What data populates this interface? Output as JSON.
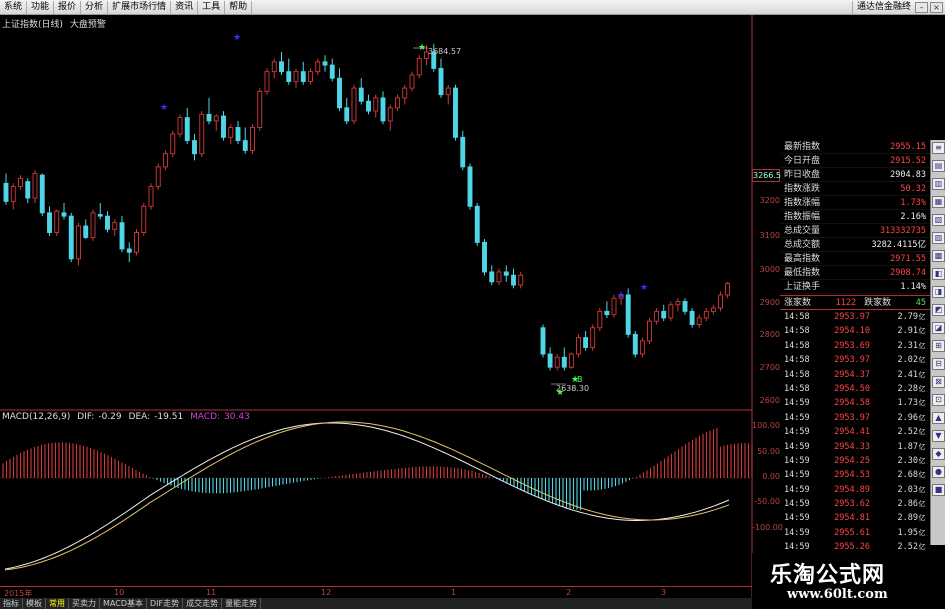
{
  "menu": {
    "items": [
      "系统",
      "功能",
      "报价",
      "分析",
      "扩展市场行情",
      "资讯",
      "工具",
      "帮助"
    ],
    "brand": "通达信金融终"
  },
  "chart_header": {
    "index_name": "上证指数(日线)",
    "indicator_name": "大盘预警"
  },
  "chart_data": {
    "type": "candlestick",
    "y_ticks": [
      "3200",
      "3100",
      "3000",
      "2900",
      "2800",
      "2700",
      "2600"
    ],
    "current_price_label": "3266.5",
    "annotations": {
      "high": "3684.57",
      "low": "2638.30",
      "buy_label": "B"
    },
    "candles": [
      [
        3260,
        3290,
        3195,
        3205
      ],
      [
        3205,
        3260,
        3180,
        3250
      ],
      [
        3250,
        3285,
        3240,
        3275
      ],
      [
        3265,
        3275,
        3200,
        3215
      ],
      [
        3215,
        3300,
        3200,
        3290
      ],
      [
        3285,
        3290,
        3160,
        3170
      ],
      [
        3170,
        3190,
        3100,
        3110
      ],
      [
        3110,
        3180,
        3100,
        3175
      ],
      [
        3170,
        3200,
        3150,
        3160
      ],
      [
        3160,
        3170,
        3020,
        3030
      ],
      [
        3030,
        3140,
        3010,
        3130
      ],
      [
        3130,
        3150,
        3090,
        3095
      ],
      [
        3095,
        3180,
        3085,
        3170
      ],
      [
        3165,
        3200,
        3150,
        3160
      ],
      [
        3160,
        3175,
        3110,
        3120
      ],
      [
        3120,
        3150,
        3100,
        3140
      ],
      [
        3140,
        3160,
        3050,
        3060
      ],
      [
        3060,
        3080,
        3020,
        3050
      ],
      [
        3050,
        3120,
        3040,
        3110
      ],
      [
        3110,
        3200,
        3100,
        3190
      ],
      [
        3190,
        3260,
        3180,
        3250
      ],
      [
        3250,
        3320,
        3240,
        3310
      ],
      [
        3310,
        3360,
        3300,
        3350
      ],
      [
        3350,
        3420,
        3340,
        3410
      ],
      [
        3410,
        3470,
        3400,
        3460
      ],
      [
        3460,
        3490,
        3380,
        3390
      ],
      [
        3390,
        3410,
        3330,
        3350
      ],
      [
        3350,
        3480,
        3340,
        3470
      ],
      [
        3470,
        3520,
        3440,
        3450
      ],
      [
        3450,
        3470,
        3420,
        3465
      ],
      [
        3465,
        3480,
        3390,
        3400
      ],
      [
        3400,
        3440,
        3380,
        3430
      ],
      [
        3430,
        3450,
        3380,
        3390
      ],
      [
        3390,
        3430,
        3350,
        3360
      ],
      [
        3360,
        3440,
        3350,
        3430
      ],
      [
        3430,
        3550,
        3420,
        3540
      ],
      [
        3540,
        3610,
        3530,
        3600
      ],
      [
        3600,
        3640,
        3580,
        3630
      ],
      [
        3630,
        3660,
        3590,
        3600
      ],
      [
        3600,
        3640,
        3560,
        3570
      ],
      [
        3570,
        3610,
        3550,
        3600
      ],
      [
        3600,
        3630,
        3560,
        3570
      ],
      [
        3570,
        3610,
        3560,
        3600
      ],
      [
        3600,
        3640,
        3590,
        3630
      ],
      [
        3630,
        3650,
        3600,
        3620
      ],
      [
        3620,
        3640,
        3570,
        3580
      ],
      [
        3580,
        3610,
        3480,
        3490
      ],
      [
        3490,
        3520,
        3440,
        3450
      ],
      [
        3450,
        3560,
        3440,
        3550
      ],
      [
        3550,
        3580,
        3500,
        3510
      ],
      [
        3510,
        3530,
        3470,
        3480
      ],
      [
        3480,
        3530,
        3460,
        3520
      ],
      [
        3520,
        3540,
        3440,
        3450
      ],
      [
        3450,
        3500,
        3420,
        3490
      ],
      [
        3490,
        3530,
        3480,
        3520
      ],
      [
        3520,
        3560,
        3500,
        3550
      ],
      [
        3550,
        3600,
        3540,
        3590
      ],
      [
        3590,
        3650,
        3580,
        3640
      ],
      [
        3640,
        3680,
        3620,
        3660
      ],
      [
        3660,
        3685,
        3600,
        3610
      ],
      [
        3610,
        3640,
        3520,
        3530
      ],
      [
        3530,
        3560,
        3500,
        3550
      ],
      [
        3550,
        3560,
        3390,
        3400
      ],
      [
        3400,
        3420,
        3300,
        3310
      ],
      [
        3310,
        3320,
        3180,
        3190
      ],
      [
        3190,
        3200,
        3070,
        3080
      ],
      [
        3080,
        3090,
        2980,
        2990
      ],
      [
        2990,
        3010,
        2950,
        2960
      ],
      [
        2960,
        3000,
        2950,
        2990
      ],
      [
        2990,
        3010,
        2960,
        2980
      ],
      [
        2980,
        3000,
        2940,
        2950
      ],
      [
        2950,
        2990,
        2940,
        2980
      ]
    ],
    "candles2": [
      [
        2820,
        2830,
        2730,
        2740
      ],
      [
        2740,
        2760,
        2690,
        2700
      ],
      [
        2700,
        2740,
        2690,
        2730
      ],
      [
        2730,
        2760,
        2690,
        2700
      ],
      [
        2700,
        2745,
        2695,
        2740
      ],
      [
        2740,
        2800,
        2730,
        2790
      ],
      [
        2790,
        2810,
        2750,
        2760
      ],
      [
        2760,
        2830,
        2750,
        2820
      ],
      [
        2820,
        2880,
        2810,
        2870
      ],
      [
        2870,
        2900,
        2850,
        2860
      ],
      [
        2860,
        2920,
        2850,
        2910
      ],
      [
        2910,
        2930,
        2890,
        2920
      ],
      [
        2920,
        2940,
        2790,
        2800
      ],
      [
        2800,
        2810,
        2730,
        2740
      ],
      [
        2740,
        2790,
        2730,
        2780
      ],
      [
        2780,
        2850,
        2770,
        2840
      ],
      [
        2840,
        2880,
        2830,
        2870
      ],
      [
        2870,
        2890,
        2840,
        2850
      ],
      [
        2850,
        2900,
        2840,
        2890
      ],
      [
        2890,
        2910,
        2870,
        2900
      ],
      [
        2900,
        2910,
        2860,
        2870
      ],
      [
        2870,
        2880,
        2820,
        2830
      ],
      [
        2830,
        2860,
        2820,
        2850
      ],
      [
        2850,
        2880,
        2840,
        2870
      ],
      [
        2870,
        2890,
        2860,
        2880
      ],
      [
        2880,
        2930,
        2870,
        2920
      ],
      [
        2920,
        2960,
        2910,
        2955
      ]
    ],
    "macd": {
      "dif": "-0.29",
      "dea": "-19.51",
      "macd": "30.43",
      "params": "MACD(12,26,9)",
      "y_ticks": [
        "100.00",
        "50.00",
        "0.00",
        "-50.00",
        "-100.00"
      ]
    },
    "x_labels": [
      "2015年",
      "10",
      "11",
      "12",
      "1",
      "2",
      "3"
    ]
  },
  "info_panel": {
    "rows": [
      {
        "label": "最新指数",
        "value": "2955.15",
        "tone": "red"
      },
      {
        "label": "今日开盘",
        "value": "2915.52",
        "tone": "red"
      },
      {
        "label": "昨日收盘",
        "value": "2904.83",
        "tone": "white"
      },
      {
        "label": "指数涨跌",
        "value": "50.32",
        "tone": "red"
      },
      {
        "label": "指数涨幅",
        "value": "1.73%",
        "tone": "red"
      },
      {
        "label": "指数振幅",
        "value": "2.16%",
        "tone": "white"
      },
      {
        "label": "总成交量",
        "value": "313332735",
        "tone": "red"
      },
      {
        "label": "总成交额",
        "value": "3282.4115亿",
        "tone": "white"
      },
      {
        "label": "最高指数",
        "value": "2971.55",
        "tone": "red"
      },
      {
        "label": "最低指数",
        "value": "2908.74",
        "tone": "red"
      },
      {
        "label": "上证换手",
        "value": "1.14%",
        "tone": "white"
      }
    ],
    "up_label": "涨家数",
    "up_value": "1122",
    "down_label": "跌家数",
    "down_value": "45"
  },
  "ticks": [
    {
      "time": "14:58",
      "price": "2953.97",
      "vol": "2.79",
      "side": "亿"
    },
    {
      "time": "14:58",
      "price": "2954.10",
      "vol": "2.91",
      "side": "亿"
    },
    {
      "time": "14:58",
      "price": "2953.69",
      "vol": "2.31",
      "side": "亿"
    },
    {
      "time": "14:58",
      "price": "2953.97",
      "vol": "2.02",
      "side": "亿"
    },
    {
      "time": "14:58",
      "price": "2954.37",
      "vol": "2.41",
      "side": "亿"
    },
    {
      "time": "14:58",
      "price": "2954.50",
      "vol": "2.28",
      "side": "亿"
    },
    {
      "time": "14:59",
      "price": "2954.58",
      "vol": "1.73",
      "side": "亿"
    },
    {
      "time": "14:59",
      "price": "2953.97",
      "vol": "2.96",
      "side": "亿"
    },
    {
      "time": "14:59",
      "price": "2954.41",
      "vol": "2.52",
      "side": "亿"
    },
    {
      "time": "14:59",
      "price": "2954.33",
      "vol": "1.87",
      "side": "亿"
    },
    {
      "time": "14:59",
      "price": "2954.25",
      "vol": "2.30",
      "side": "亿"
    },
    {
      "time": "14:59",
      "price": "2954.53",
      "vol": "2.68",
      "side": "亿"
    },
    {
      "time": "14:59",
      "price": "2954.89",
      "vol": "2.03",
      "side": "亿"
    },
    {
      "time": "14:59",
      "price": "2953.62",
      "vol": "2.86",
      "side": "亿"
    },
    {
      "time": "14:59",
      "price": "2954.81",
      "vol": "2.89",
      "side": "亿"
    },
    {
      "time": "14:59",
      "price": "2955.61",
      "vol": "1.95",
      "side": "亿"
    },
    {
      "time": "14:59",
      "price": "2955.26",
      "vol": "2.52",
      "side": "亿"
    }
  ],
  "watermark": {
    "title": "乐淘公式网",
    "url": "www.60lt.com"
  },
  "bottom_tabs": [
    "指标",
    "模板",
    "常用",
    "买卖力",
    "MACD基本",
    "DIF走势",
    "成交走势",
    "量能走势"
  ],
  "colors": {
    "up": "#d03a3a",
    "down": "#4fd6e6",
    "panel_border": "#a33",
    "macd_positive": "#d03a3a",
    "macd_negative": "#4fd6e6"
  }
}
